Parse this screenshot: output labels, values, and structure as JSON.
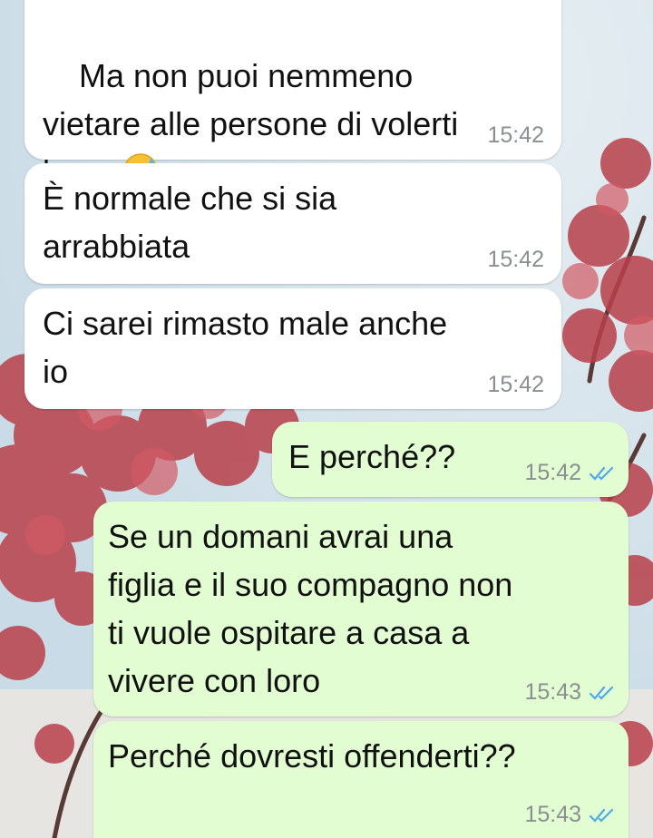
{
  "theme": {
    "incoming_bubble": "#ffffff",
    "outgoing_bubble": "#e3fdd3",
    "read_tick_color": "#4fa8e8",
    "timestamp_color": "#8a8f92"
  },
  "messages": [
    {
      "direction": "incoming",
      "text": "Ma non puoi nemmeno\nvietare alle persone di volerti\nbene",
      "emoji": "grinning-face-with-sweat-icon",
      "time": "15:42"
    },
    {
      "direction": "incoming",
      "text": "È normale che si sia\narrabbiata",
      "time": "15:42"
    },
    {
      "direction": "incoming",
      "text": "Ci sarei rimasto male anche\nio",
      "time": "15:42"
    },
    {
      "direction": "outgoing",
      "text": "E perché??",
      "time": "15:42",
      "status": "read-double-check-icon"
    },
    {
      "direction": "outgoing",
      "text": "Se un domani avrai una\nfiglia e il suo compagno non\nti vuole ospitare a casa a\nvivere con loro",
      "time": "15:43",
      "status": "read-double-check-icon"
    },
    {
      "direction": "outgoing",
      "text": "Perché dovresti offenderti??",
      "time": "15:43",
      "status": "read-double-check-icon"
    }
  ]
}
